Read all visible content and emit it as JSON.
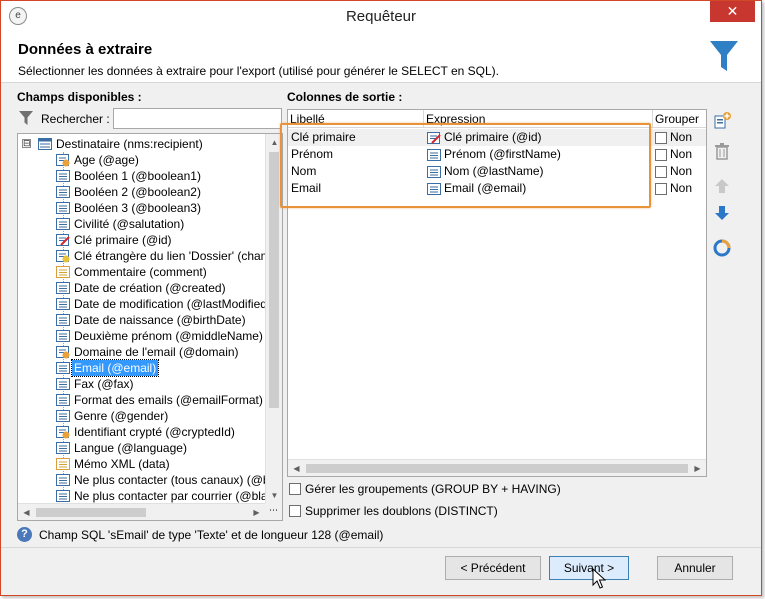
{
  "window": {
    "title": "Requêteur",
    "close_glyph": "✕",
    "app_icon_glyph": "e"
  },
  "header": {
    "title": "Données à extraire",
    "subtitle": "Sélectionner les données à extraire pour l'export (utilisé pour générer le SELECT en SQL).",
    "icon": "funnel-icon"
  },
  "left_panel": {
    "title": "Champs disponibles :",
    "search_label": "Rechercher :",
    "search_value": "",
    "tree": {
      "root": {
        "label": "Destinataire (nms:recipient)",
        "expander": "⊟",
        "icon": "table-icon"
      },
      "items": [
        {
          "label": "Age (@age)",
          "icon": "computed-field-icon",
          "selected": false
        },
        {
          "label": "Booléen 1 (@boolean1)",
          "icon": "field-icon",
          "selected": false
        },
        {
          "label": "Booléen 2 (@boolean2)",
          "icon": "field-icon",
          "selected": false
        },
        {
          "label": "Booléen 3 (@boolean3)",
          "icon": "field-icon",
          "selected": false
        },
        {
          "label": "Civilité (@salutation)",
          "icon": "field-icon",
          "selected": false
        },
        {
          "label": "Clé primaire (@id)",
          "icon": "primary-key-icon",
          "selected": false
        },
        {
          "label": "Clé étrangère du lien 'Dossier' (cham",
          "icon": "foreign-key-icon",
          "selected": false
        },
        {
          "label": "Commentaire (comment)",
          "icon": "memo-icon",
          "selected": false
        },
        {
          "label": "Date de création (@created)",
          "icon": "field-icon",
          "selected": false
        },
        {
          "label": "Date de modification (@lastModified",
          "icon": "field-icon",
          "selected": false
        },
        {
          "label": "Date de naissance (@birthDate)",
          "icon": "field-icon",
          "selected": false
        },
        {
          "label": "Deuxième prénom (@middleName)",
          "icon": "field-icon",
          "selected": false
        },
        {
          "label": "Domaine de l'email (@domain)",
          "icon": "computed-field-icon",
          "selected": false
        },
        {
          "label": "Email (@email)",
          "icon": "field-icon",
          "selected": true
        },
        {
          "label": "Fax (@fax)",
          "icon": "field-icon",
          "selected": false
        },
        {
          "label": "Format des emails (@emailFormat)",
          "icon": "field-icon",
          "selected": false
        },
        {
          "label": "Genre (@gender)",
          "icon": "field-icon",
          "selected": false
        },
        {
          "label": "Identifiant crypté (@cryptedId)",
          "icon": "computed-field-icon",
          "selected": false
        },
        {
          "label": "Langue (@language)",
          "icon": "field-icon",
          "selected": false
        },
        {
          "label": "Mémo XML (data)",
          "icon": "memo-icon",
          "selected": false
        },
        {
          "label": "Ne plus contacter (tous canaux) (@b",
          "icon": "field-icon",
          "selected": false
        },
        {
          "label": "Ne plus contacter par courrier (@bla",
          "icon": "field-icon",
          "selected": false
        }
      ]
    }
  },
  "right_panel": {
    "title": "Colonnes de sortie :",
    "columns": [
      "Libellé",
      "Expression",
      "Grouper"
    ],
    "rows": [
      {
        "label": "Clé primaire",
        "expression": "Clé primaire (@id)",
        "expr_icon": "primary-key-icon",
        "group": "Non"
      },
      {
        "label": "Prénom",
        "expression": "Prénom (@firstName)",
        "expr_icon": "field-icon",
        "group": "Non"
      },
      {
        "label": "Nom",
        "expression": "Nom (@lastName)",
        "expr_icon": "field-icon",
        "group": "Non"
      },
      {
        "label": "Email",
        "expression": "Email (@email)",
        "expr_icon": "field-icon",
        "group": "Non"
      }
    ],
    "side_buttons": [
      "add-icon",
      "delete-icon",
      "move-up-icon",
      "move-down-icon",
      "distribution-icon"
    ]
  },
  "options": {
    "group_label": "Gérer les groupements (GROUP BY + HAVING)",
    "group_checked": false,
    "distinct_label": "Supprimer les doublons (DISTINCT)",
    "distinct_checked": false
  },
  "info": {
    "text": "Champ SQL 'sEmail' de type 'Texte' et de longueur 128 (@email)",
    "icon": "help-icon",
    "glyph": "?"
  },
  "footer": {
    "prev_label": "< Précédent",
    "next_label": "Suivant >",
    "cancel_label": "Annuler"
  },
  "colors": {
    "selection": "#3399ff",
    "highlight_frame": "#e8933a",
    "close_button": "#c7372f",
    "funnel": "#2f7fc4"
  }
}
